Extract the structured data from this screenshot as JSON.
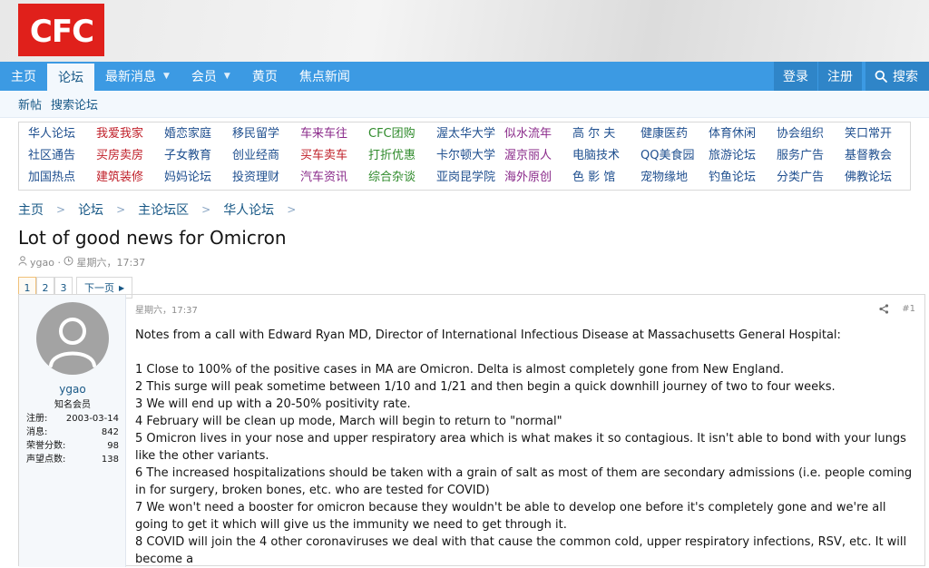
{
  "header": {
    "logo_text": "CFC"
  },
  "nav": {
    "items": [
      {
        "label": "主页",
        "active": false,
        "dropdown": false
      },
      {
        "label": "论坛",
        "active": true,
        "dropdown": false
      },
      {
        "label": "最新消息",
        "active": false,
        "dropdown": true
      },
      {
        "label": "会员",
        "active": false,
        "dropdown": true
      },
      {
        "label": "黄页",
        "active": false,
        "dropdown": false
      },
      {
        "label": "焦点新闻",
        "active": false,
        "dropdown": false
      }
    ],
    "login": "登录",
    "register": "注册",
    "search": "搜索"
  },
  "subnav": {
    "new_posts": "新帖",
    "search_forum": "搜索论坛"
  },
  "forums": [
    [
      {
        "t": "华人论坛",
        "c": "blue"
      },
      {
        "t": "我爱我家",
        "c": "red"
      },
      {
        "t": "婚恋家庭",
        "c": "blue"
      },
      {
        "t": "移民留学",
        "c": "blue"
      },
      {
        "t": "车来车往",
        "c": "purple"
      },
      {
        "t": "CFC团购",
        "c": "green"
      },
      {
        "t": "渥太华大学",
        "c": "blue"
      },
      {
        "t": "似水流年",
        "c": "purple"
      },
      {
        "t": "高 尔 夫",
        "c": "blue"
      },
      {
        "t": "健康医药",
        "c": "blue"
      },
      {
        "t": "体育休闲",
        "c": "blue"
      },
      {
        "t": "协会组织",
        "c": "blue"
      },
      {
        "t": "笑口常开",
        "c": "blue"
      }
    ],
    [
      {
        "t": "社区通告",
        "c": "blue"
      },
      {
        "t": "买房卖房",
        "c": "red"
      },
      {
        "t": "子女教育",
        "c": "blue"
      },
      {
        "t": "创业经商",
        "c": "blue"
      },
      {
        "t": "买车卖车",
        "c": "red"
      },
      {
        "t": "打折优惠",
        "c": "green"
      },
      {
        "t": "卡尔顿大学",
        "c": "blue"
      },
      {
        "t": "渥京丽人",
        "c": "purple"
      },
      {
        "t": "电脑技术",
        "c": "blue"
      },
      {
        "t": "QQ美食园",
        "c": "blue"
      },
      {
        "t": "旅游论坛",
        "c": "blue"
      },
      {
        "t": "服务广告",
        "c": "blue"
      },
      {
        "t": "基督教会",
        "c": "blue"
      }
    ],
    [
      {
        "t": "加国热点",
        "c": "blue"
      },
      {
        "t": "建筑装修",
        "c": "red"
      },
      {
        "t": "妈妈论坛",
        "c": "blue"
      },
      {
        "t": "投资理财",
        "c": "blue"
      },
      {
        "t": "汽车资讯",
        "c": "purple"
      },
      {
        "t": "综合杂谈",
        "c": "green"
      },
      {
        "t": "亚岗昆学院",
        "c": "blue"
      },
      {
        "t": "海外原创",
        "c": "purple"
      },
      {
        "t": "色 影 馆",
        "c": "blue"
      },
      {
        "t": "宠物缘地",
        "c": "blue"
      },
      {
        "t": "钓鱼论坛",
        "c": "blue"
      },
      {
        "t": "分类广告",
        "c": "blue"
      },
      {
        "t": "佛教论坛",
        "c": "blue"
      }
    ]
  ],
  "breadcrumb": [
    "主页",
    "论坛",
    "主论坛区",
    "华人论坛"
  ],
  "thread": {
    "title": "Lot of good news for Omicron",
    "author": "ygao",
    "date": "星期六，17:37"
  },
  "pagination": {
    "pages": [
      "1",
      "2",
      "3"
    ],
    "current": "1",
    "next": "下一页"
  },
  "post": {
    "user": {
      "name": "ygao",
      "title": "知名会员",
      "stats": [
        {
          "label": "注册:",
          "value": "2003-03-14"
        },
        {
          "label": "消息:",
          "value": "842"
        },
        {
          "label": "荣誉分数:",
          "value": "98"
        },
        {
          "label": "声望点数:",
          "value": "138"
        }
      ]
    },
    "date": "星期六，17:37",
    "number": "#1",
    "lead": "Notes from a call with Edward Ryan MD, Director of International Infectious Disease at Massachusetts General Hospital:",
    "lines": [
      "1 Close to 100% of the positive cases in MA are Omicron. Delta is almost completely gone from New England.",
      "2 This surge will peak sometime between 1/10 and 1/21 and then begin a quick downhill journey of two to four weeks.",
      "3 We will end up with a 20-50% positivity rate.",
      "4 February will be clean up mode, March will begin to return to \"normal\"",
      "5 Omicron lives in your nose and upper respiratory area which is what makes it so contagious. It isn't able to bond with your lungs like the other variants.",
      "6 The increased hospitalizations should be taken with a grain of salt as most of them are secondary admissions (i.e. people coming in for surgery, broken bones, etc. who are tested for COVID)",
      "7 We won't need a booster for omicron because they wouldn't be able to develop one before it's completely gone and we're all going to get it which will give us the immunity we need to get through it.",
      "8 COVID will join the 4 other coronaviruses we deal with that cause the common cold, upper respiratory infections, RSV, etc. It will become a"
    ]
  }
}
